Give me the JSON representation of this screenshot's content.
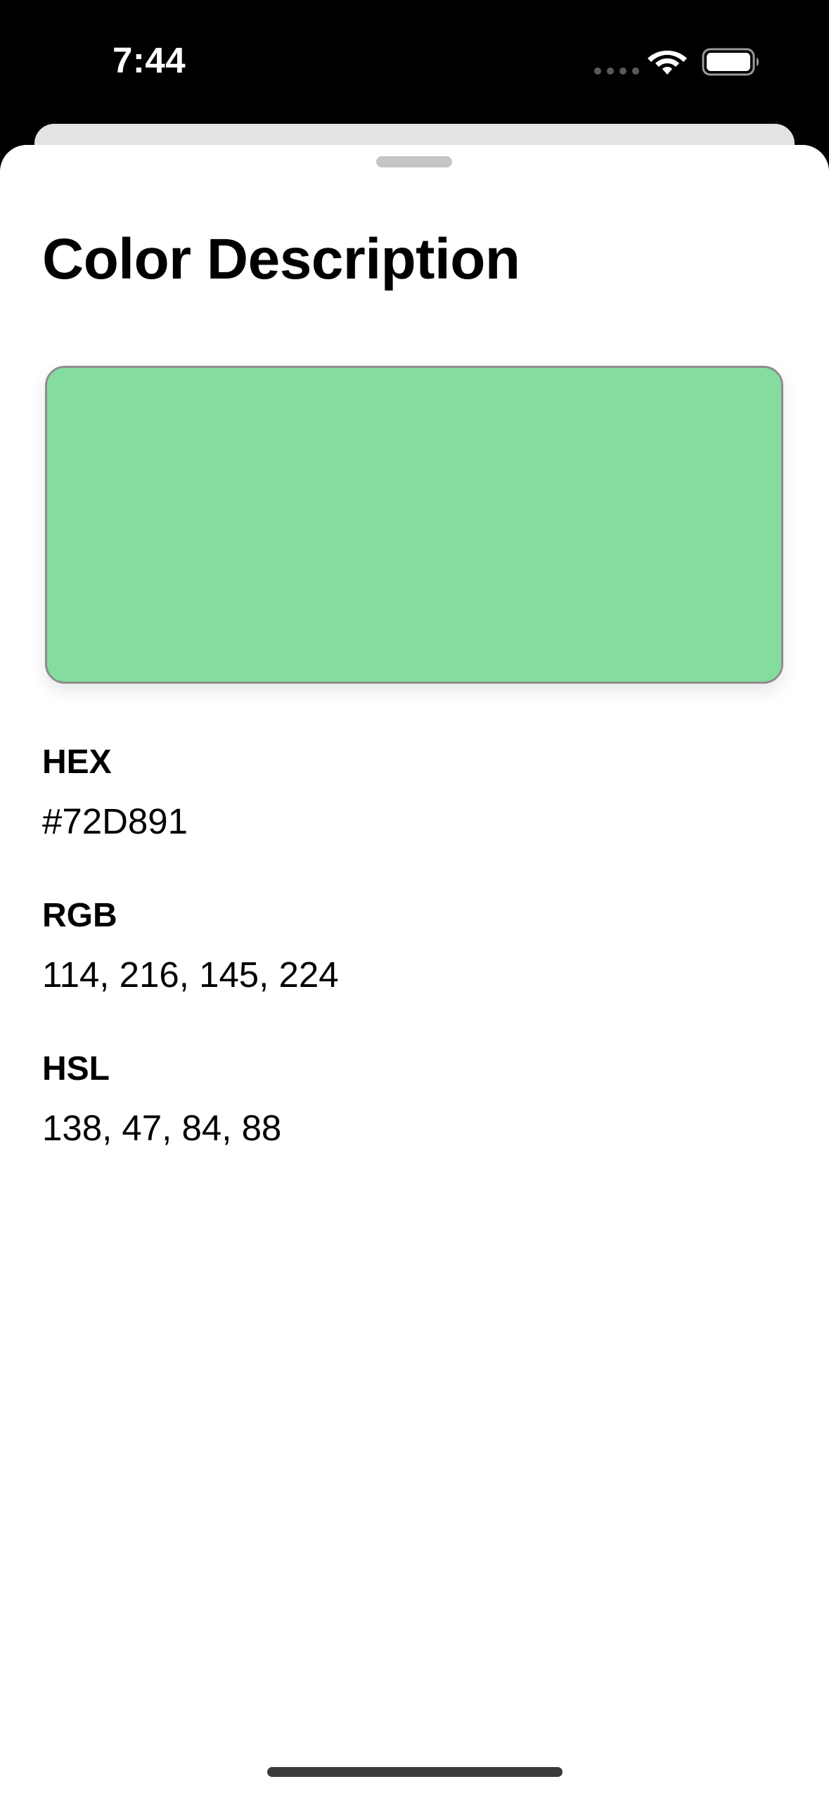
{
  "status_bar": {
    "time": "7:44",
    "icons": [
      "signal-dots-icon",
      "wifi-icon",
      "battery-icon"
    ]
  },
  "sheet": {
    "title": "Color Description",
    "swatch_color": "#84DD9E"
  },
  "details": {
    "hex": {
      "label": "HEX",
      "value": "#72D891"
    },
    "rgb": {
      "label": "RGB",
      "value": "114, 216, 145, 224"
    },
    "hsl": {
      "label": "HSL",
      "value": "138, 47, 84, 88"
    }
  },
  "colors": {
    "status_bar_bg": "#000000",
    "sheet_bg": "#FFFFFF",
    "swatch_border": "#8E8E8E",
    "text": "#000000"
  }
}
